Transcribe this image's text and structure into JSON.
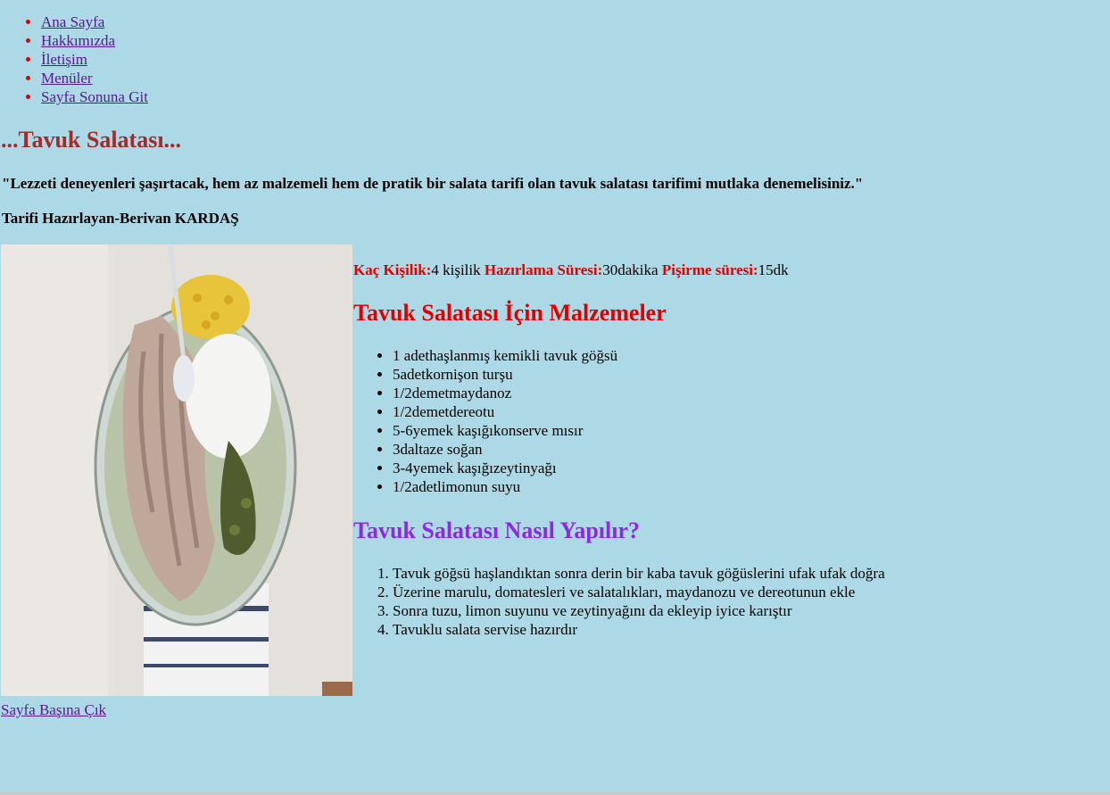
{
  "nav": {
    "items": [
      {
        "label": "Ana Sayfa"
      },
      {
        "label": "Hakkımızda"
      },
      {
        "label": "İletişim"
      },
      {
        "label": "Menüler"
      },
      {
        "label": "Sayfa Sonuna Git"
      }
    ]
  },
  "header": {
    "title": "...Tavuk Salatası...",
    "quote": "\"Lezzeti deneyenleri şaşırtacak, hem az malzemeli hem de pratik bir salata tarifi olan tavuk salatası tarifimi mutlaka denemelisiniz.\"",
    "author": "Tarifi Hazırlayan-Berivan KARDAŞ"
  },
  "meta": {
    "servings_label": "Kaç Kişilik:",
    "servings_value": "4 kişilik",
    "prep_label": "Hazırlama Süresi:",
    "prep_value": "30dakika",
    "cook_label": "Pişirme süresi:",
    "cook_value": "15dk"
  },
  "ingredients": {
    "heading": "Tavuk Salatası İçin Malzemeler",
    "items": [
      "1 adethaşlanmış kemikli tavuk göğsü",
      "5adetkornişon turşu",
      "1/2demetmaydanoz",
      "1/2demetdereotu",
      "5-6yemek kaşığıkonserve mısır",
      "3daltaze soğan",
      "3-4yemek kaşığızeytinyağı",
      "1/2adetlimonun suyu"
    ]
  },
  "instructions": {
    "heading": "Tavuk Salatası Nasıl Yapılır?",
    "steps": [
      "Tavuk göğsü haşlandıktan sonra derin bir kaba tavuk göğüslerini ufak ufak doğra",
      "Üzerine marulu, domatesleri ve salatalıkları, maydanozu ve dereotunun ekle",
      "Sonra tuzu, limon suyunu ve zeytinyağını da ekleyip iyice karıştır",
      "Tavuklu salata servise hazırdır"
    ]
  },
  "footer": {
    "back_to_top": "Sayfa Başına Çık"
  },
  "colors": {
    "background": "#add8e6",
    "title": "#a52a2a",
    "accent_red": "#e00000",
    "accent_purple": "#8a2be2",
    "link": "#551a8b"
  }
}
